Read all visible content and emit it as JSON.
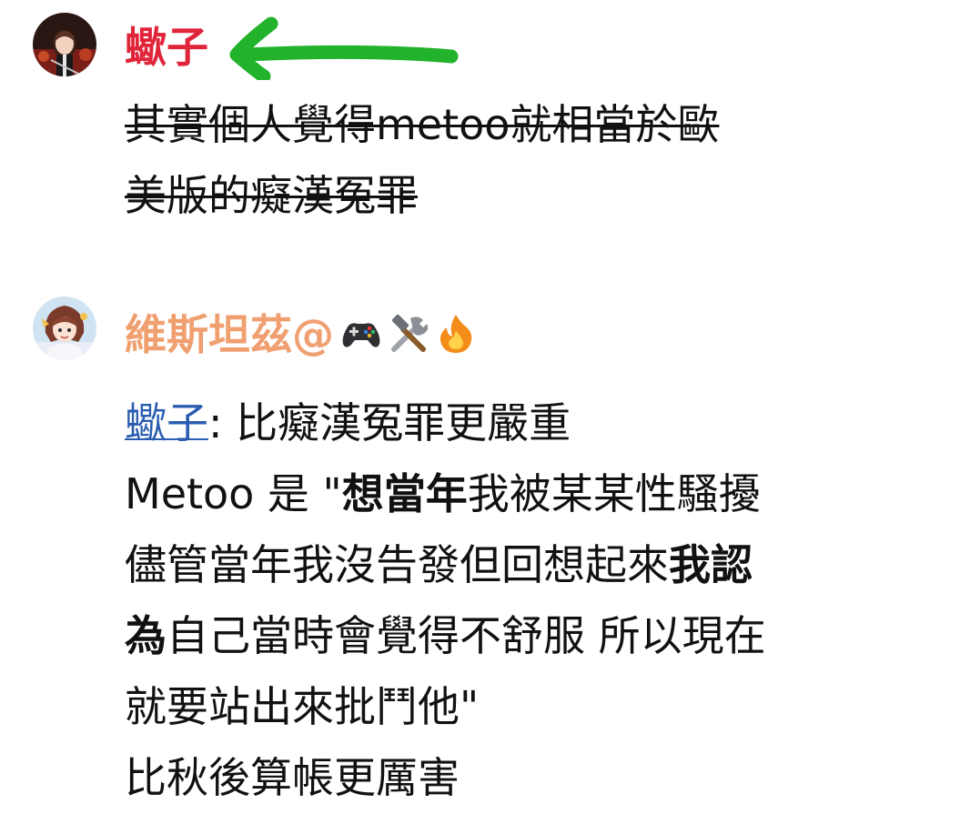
{
  "colors": {
    "username_1": "#e0243a",
    "username_2": "#f0a070",
    "mention": "#2a5db0",
    "arrow": "#22b22c",
    "text": "#111111"
  },
  "messages": [
    {
      "username": "蠍子",
      "avatar_icon": "dark-anime-avatar",
      "annotation_icon": "green-arrow-icon",
      "struck_lines": [
        "其實個人覺得metoo就相當於歐",
        "美版的癡漢冤罪"
      ]
    },
    {
      "username": "維斯坦茲@",
      "avatar_icon": "anime-girl-avatar",
      "name_emojis": [
        "gamepad-icon",
        "tools-icon",
        "fire-icon"
      ],
      "reply_mention": "蠍子",
      "reply_text": ": 比癡漢冤罪更嚴重",
      "line2_a": "Metoo 是 \"",
      "line2_b": "想當年",
      "line2_c": "我被某某性騷擾",
      "line3_a": "儘管當年我沒告發但回想起來",
      "line3_b": "我認",
      "line4_a": "為",
      "line4_b": "自己當時會覺得不舒服 所以現在",
      "line5": "就要站出來批鬥他\"",
      "line6": "比秋後算帳更厲害"
    }
  ]
}
